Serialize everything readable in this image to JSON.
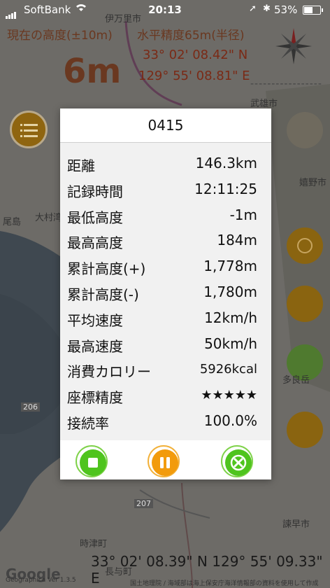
{
  "status_bar": {
    "carrier": "SoftBank",
    "time": "20:13",
    "battery_percent": "53%",
    "battery_level": 0.53
  },
  "header": {
    "altitude_label": "現在の高度(±10m)",
    "accuracy_label": "水平精度65m(半径)",
    "altitude_value": "6m",
    "latitude": "33° 02' 08.42\" N",
    "longitude": "129° 55' 08.81\" E",
    "dashes": "-----------------"
  },
  "map_labels": {
    "town_top": "伊万里市",
    "takeo": "武雄市",
    "ureshino": "嬉野市",
    "oseto": "尾島",
    "omura_bay": "大村湾",
    "tarami": "多良岳",
    "isahaya": "諫早市",
    "togitsu": "時津町",
    "nagayo": "長与町",
    "route_206": "206",
    "route_207": "207"
  },
  "dialog": {
    "title": "0415",
    "stats": [
      {
        "label": "距離",
        "value": "146.3km"
      },
      {
        "label": "記録時間",
        "value": "12:11:25"
      },
      {
        "label": "最低高度",
        "value": "-1m"
      },
      {
        "label": "最高高度",
        "value": "184m"
      },
      {
        "label": "累計高度(+)",
        "value": "1,778m"
      },
      {
        "label": "累計高度(-)",
        "value": "1,780m"
      },
      {
        "label": "平均速度",
        "value": "12km/h"
      },
      {
        "label": "最高速度",
        "value": "50km/h"
      },
      {
        "label": "消費カロリー",
        "value": "5926kcal"
      },
      {
        "label": "座標精度",
        "value": "★★★★★"
      },
      {
        "label": "接続率",
        "value": "100.0%"
      }
    ],
    "buttons": {
      "stop_icon": "stop-icon",
      "pause_icon": "pause-icon",
      "close_icon": "close-icon"
    },
    "colors": {
      "green": "#4fc41e",
      "orange": "#f29b0c"
    }
  },
  "footer": {
    "current_coordinates": "33° 02' 08.39\" N 129° 55' 09.33\" E",
    "google_logo": "Google",
    "version": "Geographica Ver 1.3.5",
    "credit": "国土地理院 / 海域部は海上保安庁海洋情報部の資料を使用して作成"
  }
}
